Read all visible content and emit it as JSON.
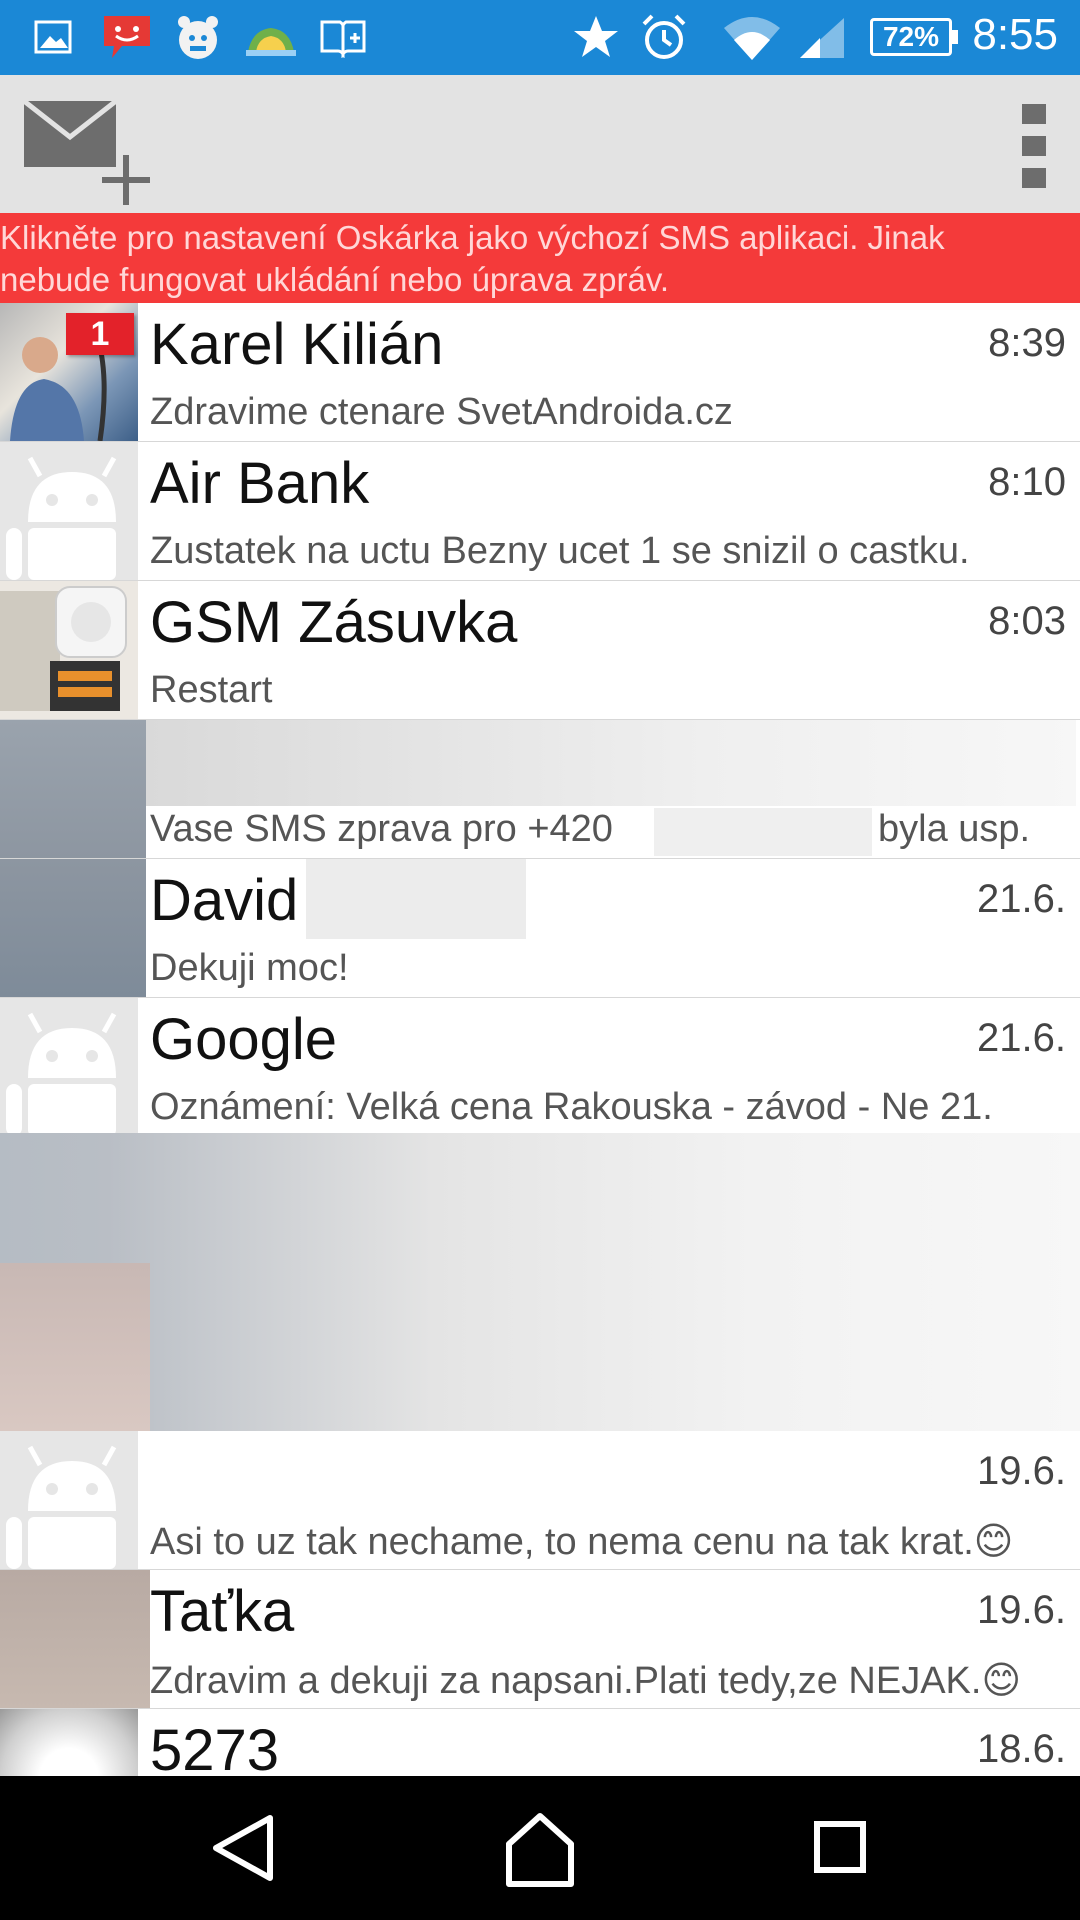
{
  "status_bar": {
    "time": "8:55",
    "battery": "72%",
    "icons": [
      "gallery-icon",
      "sms-notification-icon",
      "alarm-app-icon",
      "weather-icon",
      "book-icon",
      "star-icon",
      "alarm-clock-icon",
      "wifi-icon",
      "signal-icon",
      "battery-icon"
    ],
    "color": "#1b88d6"
  },
  "action_bar": {
    "compose_icon": "new-message-icon",
    "overflow_icon": "overflow-menu-icon",
    "color": "#e3e3e3"
  },
  "banner": {
    "line1": "Klikněte pro nastavení Oskárka jako výchozí SMS aplikaci. Jinak",
    "line2": "nebude fungovat ukládání nebo úprava zpráv.",
    "color": "#f43a3a"
  },
  "conversations": [
    {
      "name": "Karel Kilián",
      "time": "8:39",
      "snippet": "Zdravime ctenare SvetAndroida.cz",
      "badge": "1"
    },
    {
      "name": "Air Bank",
      "time": "8:10",
      "snippet": "Zustatek na uctu Bezny ucet 1 se snizil o castku."
    },
    {
      "name": "GSM Zásuvka",
      "time": "8:03",
      "snippet": "Restart"
    },
    {
      "name": "",
      "time": "",
      "snippet_prefix": "Vase SMS zprava pro +420",
      "snippet_suffix": "byla usp."
    },
    {
      "name": "David",
      "time": "21.6.",
      "snippet": "Dekuji moc!"
    },
    {
      "name": "Google",
      "time": "21.6.",
      "snippet": "Oznámení: Velká cena Rakouska - závod - Ne 21."
    },
    {
      "name": "",
      "time": "19.6.",
      "snippet": "Asi to uz tak nechame, to nema cenu na tak krat.😊"
    },
    {
      "name": "Taťka",
      "time": "19.6.",
      "snippet": "Zdravim a dekuji za napsani.Plati tedy,ze NEJAK.😊"
    },
    {
      "name": "5273",
      "time": "18.6.",
      "snippet": ""
    }
  ],
  "nav_bar": {
    "back_icon": "back-icon",
    "home_icon": "home-icon",
    "recents_icon": "recents-icon"
  }
}
